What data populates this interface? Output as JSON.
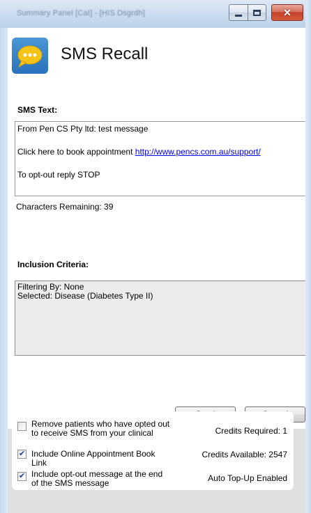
{
  "window": {
    "title": "Summary Panel [Cat] - [HIS Dsgrdh]",
    "controls": {
      "minimize": "minimize",
      "maximize": "maximize",
      "close": "✕"
    }
  },
  "app": {
    "title": "SMS Recall",
    "icon": "sms-chat-bubble-icon",
    "accent_color": "#3a86c8"
  },
  "sms": {
    "label": "SMS Text:",
    "line1": "From Pen CS Pty ltd: test message",
    "line2_prefix": "Click here to book appointment ",
    "line2_link": "http://www.pencs.com.au/support/",
    "line3": "To opt-out reply STOP",
    "characters_remaining": "Characters Remaining: 39"
  },
  "criteria": {
    "label": "Inclusion Criteria:",
    "filtering": "Filtering By: None",
    "selected": "Selected: Disease (Diabetes Type II)"
  },
  "buttons": {
    "send": "Send",
    "cancel": "Cancel"
  },
  "options": [
    {
      "label": "Remove patients who have opted out to receive SMS from your clinical",
      "checked": false
    },
    {
      "label": "Include Online Appointment Book Link",
      "checked": true
    },
    {
      "label": "Include opt-out message at the end of the SMS message",
      "checked": true
    }
  ],
  "credits": {
    "required": "Credits Required: 1",
    "available": "Credits Available: 2547",
    "auto_topup": "Auto Top-Up Enabled"
  }
}
